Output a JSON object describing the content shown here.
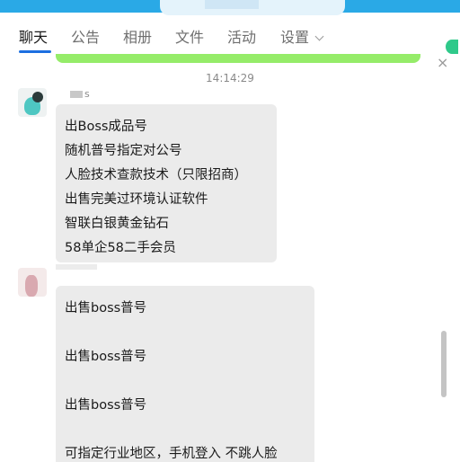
{
  "tabs": [
    {
      "label": "聊天",
      "active": true
    },
    {
      "label": "公告"
    },
    {
      "label": "相册"
    },
    {
      "label": "文件"
    },
    {
      "label": "活动"
    },
    {
      "label": "设置"
    }
  ],
  "chat": {
    "timestamp": "14:14:29",
    "messages": [
      {
        "sender": "s",
        "lines": [
          "出Boss成品号",
          "随机普号指定对公号",
          "人脸技术查款技术（只限招商）",
          "出售完美过环境认证软件",
          "智联白银黄金钻石",
          "58单企58二手会员"
        ]
      },
      {
        "lines": [
          "出售boss普号",
          "出售boss普号",
          "出售boss普号",
          "可指定行业地区，手机登入  不跳人脸"
        ]
      }
    ]
  },
  "colors": {
    "accent": "#1c6fe0",
    "my_bubble": "#95ec69",
    "other_bubble": "#ebebeb",
    "top_bar": "#2aa9e6"
  },
  "icons": {
    "settings_dropdown": "chevron-down-icon",
    "close": "close-icon"
  }
}
